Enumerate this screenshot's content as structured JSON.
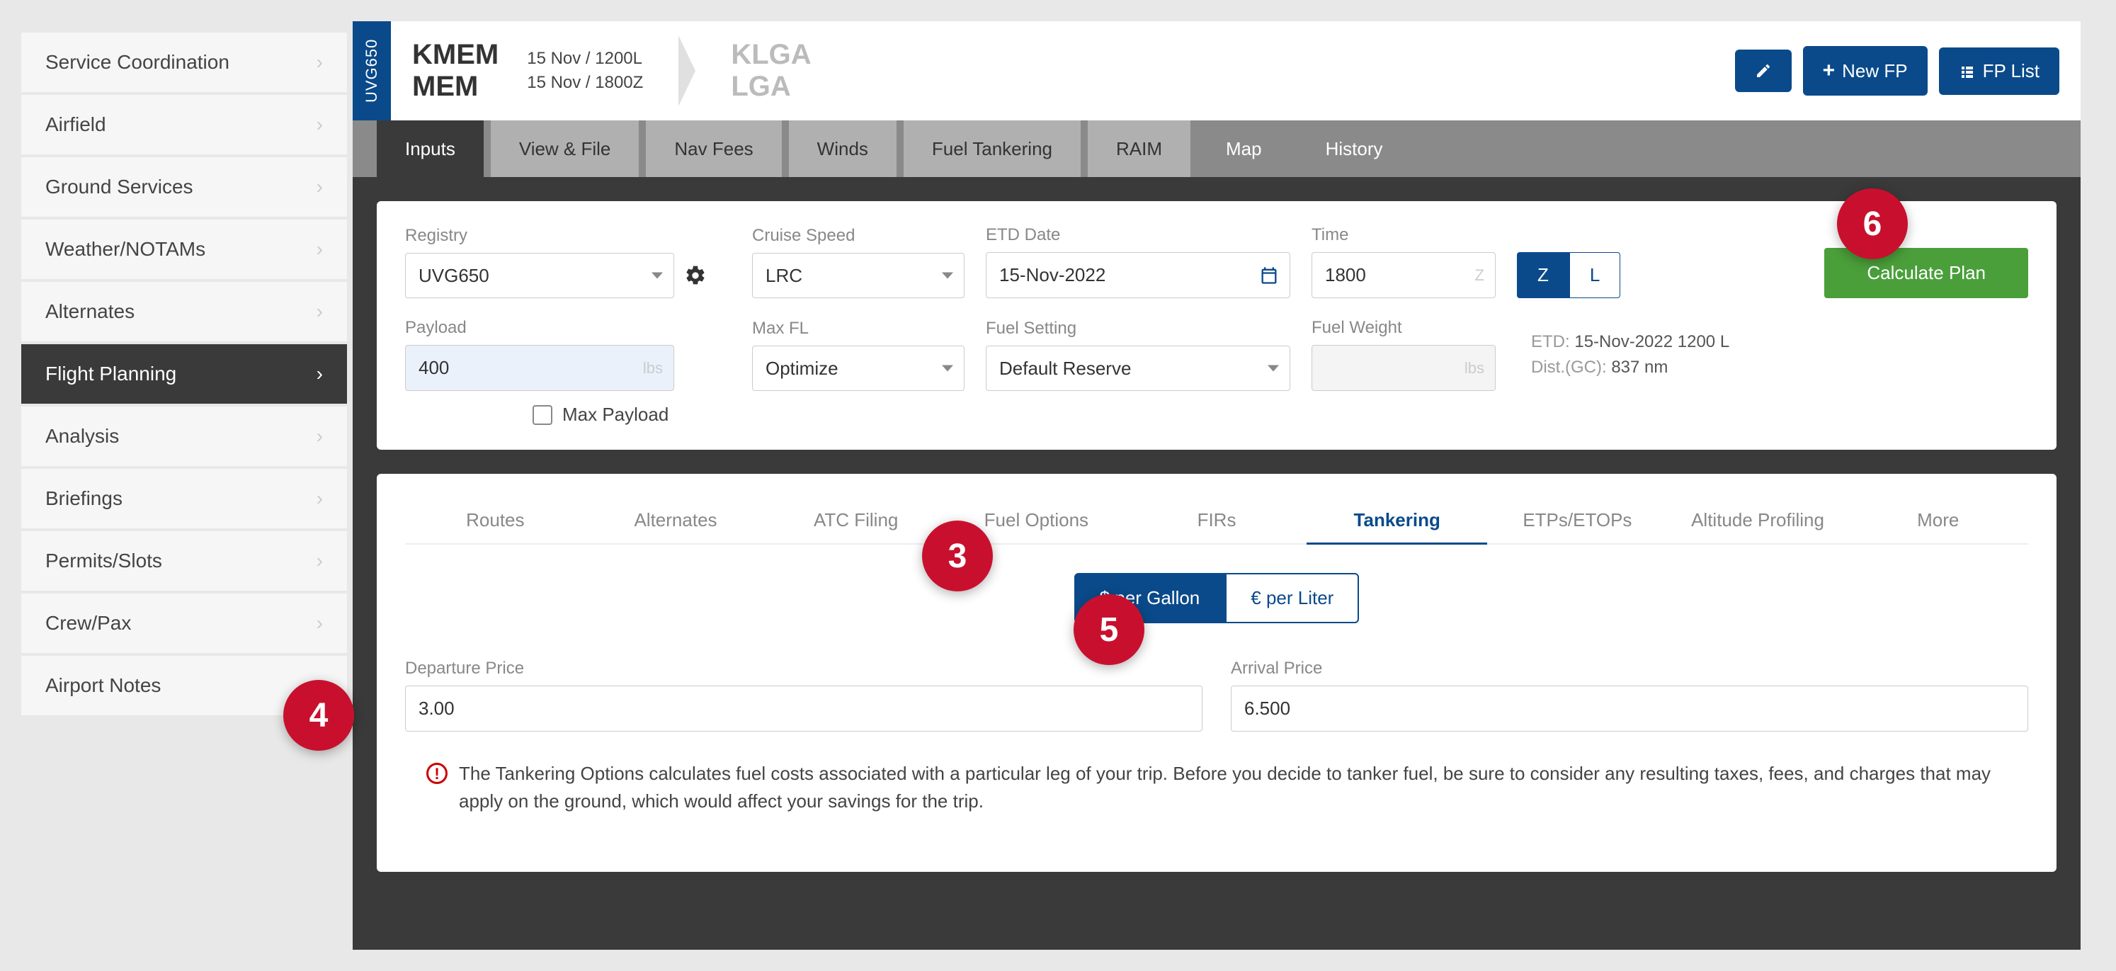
{
  "sidebar": {
    "items": [
      {
        "label": "Service Coordination"
      },
      {
        "label": "Airfield"
      },
      {
        "label": "Ground Services"
      },
      {
        "label": "Weather/NOTAMs"
      },
      {
        "label": "Alternates"
      },
      {
        "label": "Flight Planning",
        "active": true
      },
      {
        "label": "Analysis"
      },
      {
        "label": "Briefings"
      },
      {
        "label": "Permits/Slots"
      },
      {
        "label": "Crew/Pax"
      },
      {
        "label": "Airport Notes"
      }
    ]
  },
  "header": {
    "aircraft_tag": "UVG650",
    "dep": {
      "icao": "KMEM",
      "iata": "MEM"
    },
    "arr": {
      "icao": "KLGA",
      "iata": "LGA"
    },
    "date_local": "15 Nov / 1200L",
    "date_zulu": "15 Nov / 1800Z",
    "buttons": {
      "edit": "✎",
      "new_fp": "New FP",
      "fp_list": "FP List"
    }
  },
  "tabs_top": [
    "Inputs",
    "View & File",
    "Nav Fees",
    "Winds",
    "Fuel Tankering",
    "RAIM",
    "Map",
    "History"
  ],
  "tabs_top_active": "Inputs",
  "tabs_top_dark": [
    "Map",
    "History"
  ],
  "form": {
    "registry": {
      "label": "Registry",
      "value": "UVG650"
    },
    "cruise": {
      "label": "Cruise Speed",
      "value": "LRC"
    },
    "etd_date": {
      "label": "ETD Date",
      "value": "15-Nov-2022"
    },
    "time": {
      "label": "Time",
      "value": "1800",
      "unit": "Z"
    },
    "zl_active": "Z",
    "calculate": "Calculate Plan",
    "payload": {
      "label": "Payload",
      "value": "400",
      "unit": "lbs"
    },
    "max_payload": {
      "label": "Max Payload",
      "checked": false
    },
    "max_fl": {
      "label": "Max FL",
      "value": "Optimize"
    },
    "fuel_setting": {
      "label": "Fuel Setting",
      "value": "Default Reserve"
    },
    "fuel_weight": {
      "label": "Fuel Weight",
      "value": "",
      "unit": "lbs"
    },
    "summary": {
      "etd_label": "ETD:",
      "etd_value": "15-Nov-2022 1200 L",
      "dist_label": "Dist.(GC):",
      "dist_value": "837 nm"
    }
  },
  "sub_tabs": [
    "Routes",
    "Alternates",
    "ATC Filing",
    "Fuel Options",
    "FIRs",
    "Tankering",
    "ETPs/ETOPs",
    "Altitude Profiling",
    "More"
  ],
  "sub_tabs_active": "Tankering",
  "tankering": {
    "unit_per_gallon": "$ per Gallon",
    "unit_per_liter": "€ per Liter",
    "unit_active": "$ per Gallon",
    "dep_price": {
      "label": "Departure Price",
      "value": "3.00"
    },
    "arr_price": {
      "label": "Arrival Price",
      "value": "6.500"
    },
    "info": "The Tankering Options calculates fuel costs associated with a particular leg of your trip. Before you decide to tanker fuel, be sure to consider any resulting taxes, fees, and charges that may apply on the ground, which would affect your savings for the trip."
  },
  "annotations": {
    "b3": "3",
    "b4": "4",
    "b5": "5",
    "b6": "6"
  }
}
